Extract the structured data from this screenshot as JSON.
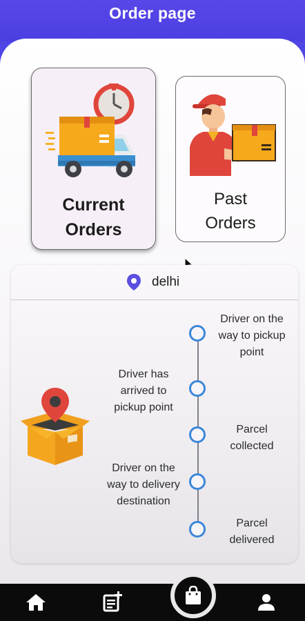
{
  "header": {
    "title": "Order page"
  },
  "cards": {
    "current": {
      "line1": "Current",
      "line2": "Orders"
    },
    "past": {
      "line1": "Past",
      "line2": "Orders"
    }
  },
  "tracking": {
    "location": "delhi",
    "steps": [
      {
        "line1": "Driver on the",
        "line2": "way to pickup",
        "line3": "point"
      },
      {
        "line1": "Driver has",
        "line2": "arrived to",
        "line3": "pickup point"
      },
      {
        "line1": "Parcel",
        "line2": "collected"
      },
      {
        "line1": "Driver on the",
        "line2": "way to delivery",
        "line3": "destination"
      },
      {
        "line1": "Parcel",
        "line2": "delivered"
      }
    ]
  },
  "nav": {
    "items": [
      "home-icon",
      "add-note-icon",
      "shopping-bag-icon",
      "person-icon"
    ]
  },
  "colors": {
    "header": "#5046e5",
    "timeline_dot": "#3b87d9",
    "pin": "#5a4fe0"
  }
}
